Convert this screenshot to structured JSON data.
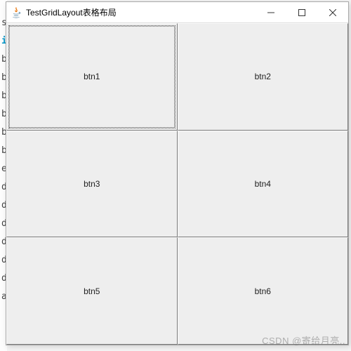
{
  "window": {
    "title": "TestGridLayout表格布局"
  },
  "buttons": {
    "b1": "btn1",
    "b2": "btn2",
    "b3": "btn3",
    "b4": "btn4",
    "b5": "btn5",
    "b6": "btn6"
  },
  "editor_chars": [
    "",
    "s",
    "i",
    "",
    "b",
    "b",
    "b",
    "b",
    "b",
    "b",
    "",
    "e",
    "",
    "d",
    "d",
    "d",
    "d",
    "d",
    "d",
    "",
    "a"
  ],
  "watermark": "CSDN @寄给月亮.."
}
